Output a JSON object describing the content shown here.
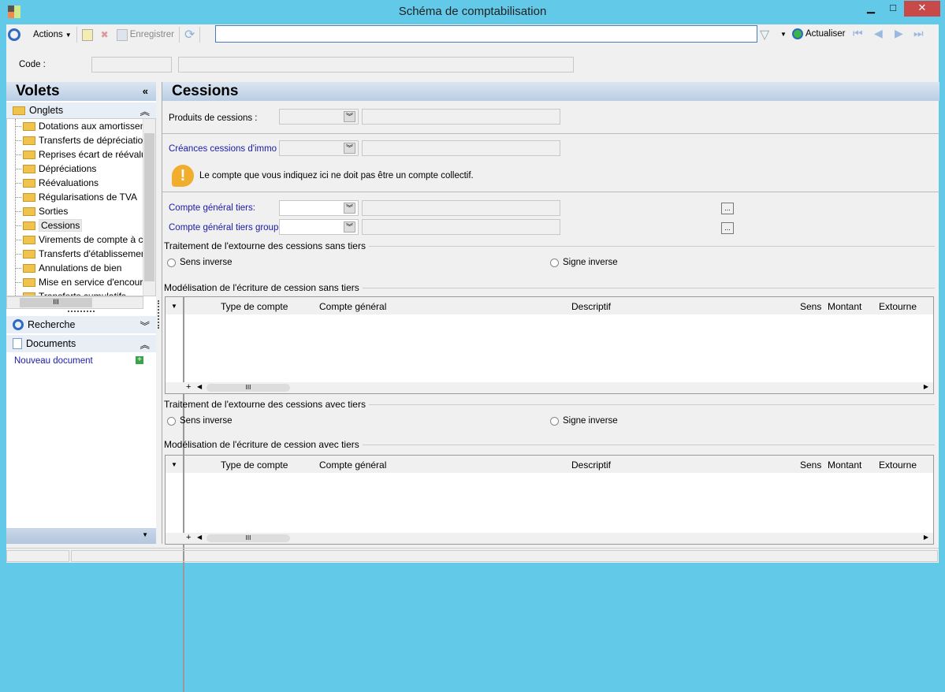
{
  "window": {
    "title": "Schéma de comptabilisation",
    "min": "▁",
    "max": "□",
    "close": "✕"
  },
  "toolbar": {
    "actions": "Actions",
    "save": "Enregistrer",
    "refresh": "Actualiser",
    "search_value": ""
  },
  "code": {
    "label": "Code :",
    "value": "",
    "value2": ""
  },
  "sidebar": {
    "title": "Volets",
    "onglets": "Onglets",
    "items": [
      {
        "label": "Dotations aux amortissements"
      },
      {
        "label": "Transferts de dépréciations"
      },
      {
        "label": "Reprises écart de réévaluation"
      },
      {
        "label": "Dépréciations"
      },
      {
        "label": "Réévaluations"
      },
      {
        "label": "Régularisations de TVA"
      },
      {
        "label": "Sorties"
      },
      {
        "label": "Cessions"
      },
      {
        "label": "Virements de compte à compte"
      },
      {
        "label": "Transferts d'établissement"
      },
      {
        "label": "Annulations de bien"
      },
      {
        "label": "Mise en service d'encours"
      },
      {
        "label": "Transferts cumulatifs"
      }
    ],
    "selected": "Cessions",
    "recherche": "Recherche",
    "documents": "Documents",
    "new_doc": "Nouveau document"
  },
  "main": {
    "title": "Cessions",
    "produits_label": "Produits de cessions :",
    "creances_label": "Créances cessions d'immo :",
    "warning": "Le compte que vous indiquez ici ne doit pas être un compte collectif.",
    "tiers_label": "Compte général tiers:",
    "tiers_groupe_label": "Compte général tiers groupe:",
    "ellipsis": "...",
    "group1": "Traitement de l'extourne des cessions sans tiers",
    "group2": "Modélisation de l'écriture de cession sans tiers",
    "group3": "Traitement de l'extourne des cessions avec tiers",
    "group4": "Modélisation de l'écriture de cession avec tiers",
    "radio_sens": "Sens inverse",
    "radio_signe": "Signe inverse",
    "columns": [
      "Type de compte",
      "Compte général",
      "Descriptif",
      "Sens",
      "Montant",
      "Extourne"
    ]
  }
}
